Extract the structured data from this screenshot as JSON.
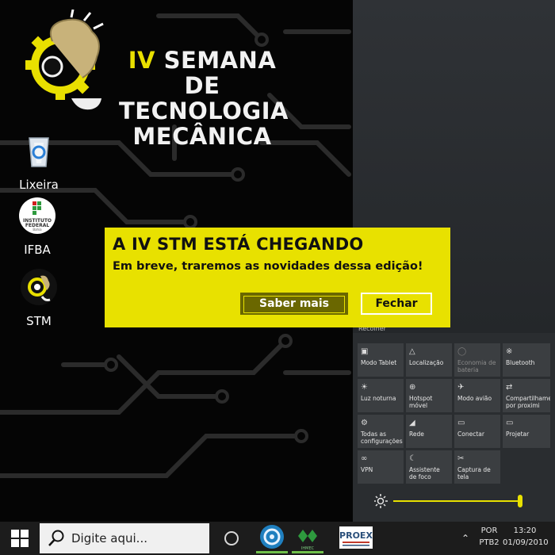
{
  "wallpaper": {
    "title_line1_accent": "IV",
    "title_line1_rest": "SEMANA DE",
    "title_line2": "TECNOLOGIA",
    "title_line3": "MECÂNICA",
    "accent_color": "#e9e000"
  },
  "desktop_icons": [
    {
      "label": "Lixeira",
      "icon": "recycle-bin-icon"
    },
    {
      "label": "IFBA",
      "icon": "instituto-federal-icon",
      "badge_line1": "INSTITUTO",
      "badge_line2": "FEDERAL",
      "badge_line3": "Bahia"
    },
    {
      "label": "STM",
      "icon": "stm-gear-bulb-icon"
    }
  ],
  "dialog": {
    "title": "A IV STM ESTÁ CHEGANDO",
    "message": "Em breve, traremos as novidades dessa edição!",
    "primary_button": "Saber mais",
    "secondary_button": "Fechar",
    "background": "#e8e100"
  },
  "action_center": {
    "collapse_label": "Recolher",
    "tiles": [
      {
        "label": "Modo Tablet",
        "icon": "tablet-mode-icon",
        "enabled": true
      },
      {
        "label": "Localização",
        "icon": "location-icon",
        "enabled": true
      },
      {
        "label": "Economia de bateria",
        "icon": "battery-saver-icon",
        "enabled": false
      },
      {
        "label": "Bluetooth",
        "icon": "bluetooth-icon",
        "enabled": true
      },
      {
        "label": "Luz noturna",
        "icon": "night-light-icon",
        "enabled": true
      },
      {
        "label": "Hotspot móvel",
        "icon": "mobile-hotspot-icon",
        "enabled": true
      },
      {
        "label": "Modo avião",
        "icon": "airplane-icon",
        "enabled": true
      },
      {
        "label": "Compartilhamento por proximi",
        "icon": "nearby-sharing-icon",
        "enabled": true
      },
      {
        "label": "Todas as configurações",
        "icon": "settings-gear-icon",
        "enabled": true
      },
      {
        "label": "Rede",
        "icon": "network-icon",
        "enabled": true
      },
      {
        "label": "Conectar",
        "icon": "connect-icon",
        "enabled": true
      },
      {
        "label": "Projetar",
        "icon": "project-icon",
        "enabled": true
      },
      {
        "label": "VPN",
        "icon": "vpn-icon",
        "enabled": true
      },
      {
        "label": "Assistente de foco",
        "icon": "focus-assist-icon",
        "enabled": true
      },
      {
        "label": "Captura de tela",
        "icon": "screen-snip-icon",
        "enabled": true
      }
    ],
    "brightness_percent": 100,
    "accent_color": "#e8e100"
  },
  "taskbar": {
    "search_placeholder": "Digite aqui...",
    "pinned_apps": [
      {
        "name": "stm-app",
        "active": true
      },
      {
        "name": "ihmec-app",
        "label": "IHMEC",
        "active": true
      },
      {
        "name": "proex-app",
        "label": "PROEX",
        "active": false
      }
    ],
    "language_line1": "POR",
    "language_line2": "PTB2",
    "time": "13:20",
    "date": "01/09/2010"
  }
}
